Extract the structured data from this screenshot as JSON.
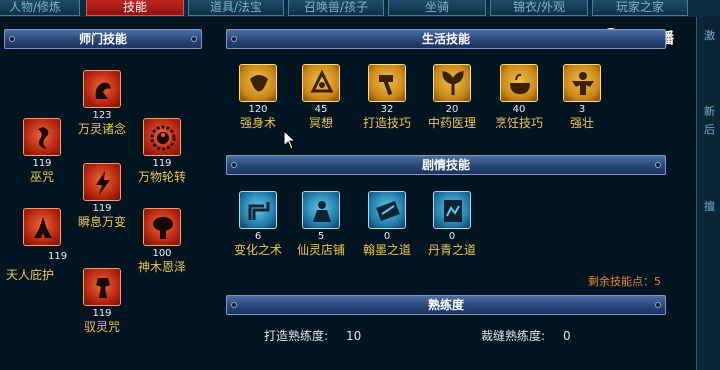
{
  "tabs": [
    {
      "label": "人物/修炼"
    },
    {
      "label": "技能"
    },
    {
      "label": "道具/法宝"
    },
    {
      "label": "召唤兽/孩子"
    },
    {
      "label": "坐骑"
    },
    {
      "label": "锦衣/外观"
    },
    {
      "label": "玩家之家"
    }
  ],
  "logo": {
    "text": "CC直播"
  },
  "right_strip": {
    "chars": [
      "激",
      "新",
      "后",
      "擅"
    ]
  },
  "sections": {
    "school": "师门技能",
    "life": "生活技能",
    "story": "剧情技能",
    "proficiency": "熟练度"
  },
  "school_skills": [
    {
      "name": "万灵诸念",
      "level": "123"
    },
    {
      "name": "巫咒",
      "level": "119"
    },
    {
      "name": "万物轮转",
      "level": "119"
    },
    {
      "name": "瞬息万变",
      "level": "119"
    },
    {
      "name": "天人庇护",
      "level": "119"
    },
    {
      "name": "神木恩泽",
      "level": "100"
    },
    {
      "name": "驭灵咒",
      "level": "119"
    }
  ],
  "life_skills": [
    {
      "name": "强身术",
      "level": "120"
    },
    {
      "name": "冥想",
      "level": "45"
    },
    {
      "name": "打造技巧",
      "level": "32"
    },
    {
      "name": "中药医理",
      "level": "20"
    },
    {
      "name": "烹饪技巧",
      "level": "40"
    },
    {
      "name": "强壮",
      "level": "3"
    }
  ],
  "story_skills": [
    {
      "name": "变化之术",
      "level": "6"
    },
    {
      "name": "仙灵店铺",
      "level": "5"
    },
    {
      "name": "翰墨之道",
      "level": "0"
    },
    {
      "name": "丹青之道",
      "level": "0"
    }
  ],
  "remaining_points": "剩余技能点：5",
  "proficiency": {
    "forge_label": "打造熟练度:",
    "forge_value": "10",
    "tailor_label": "裁缝熟练度:",
    "tailor_value": "0"
  }
}
